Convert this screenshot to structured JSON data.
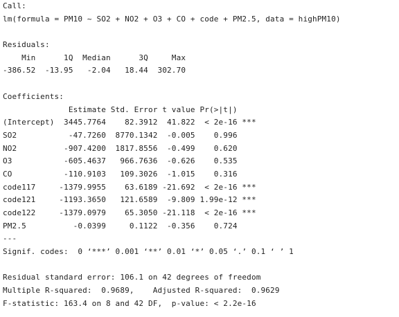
{
  "output": {
    "lines": [
      "Call:",
      "lm(formula = PM10 ~ SO2 + NO2 + O3 + CO + code + PM2.5, data = highPM10)",
      "",
      "Residuals:",
      "    Min      1Q  Median      3Q     Max ",
      "-386.52  -13.95   -2.04   18.44  302.70 ",
      "",
      "Coefficients:",
      "              Estimate Std. Error t value Pr(>|t|)    ",
      "(Intercept)  3445.7764    82.3912  41.822  < 2e-16 ***",
      "SO2           -47.7260  8770.1342  -0.005    0.996    ",
      "NO2          -907.4200  1817.8556  -0.499    0.620    ",
      "O3           -605.4637   966.7636  -0.626    0.535    ",
      "CO           -110.9103   109.3026  -1.015    0.316    ",
      "code117     -1379.9955    63.6189 -21.692  < 2e-16 ***",
      "code121     -1193.3650   121.6589  -9.809 1.99e-12 ***",
      "code122     -1379.0979    65.3050 -21.118  < 2e-16 ***",
      "PM2.5          -0.0399     0.1122  -0.356    0.724    ",
      "---",
      "Signif. codes:  0 ‘***’ 0.001 ‘**’ 0.01 ‘*’ 0.05 ‘.’ 0.1 ‘ ’ 1",
      "",
      "Residual standard error: 106.1 on 42 degrees of freedom",
      "Multiple R-squared:  0.9689,\tAdjusted R-squared:  0.9629 ",
      "F-statistic: 163.4 on 8 and 42 DF,  p-value: < 2.2e-16"
    ]
  }
}
